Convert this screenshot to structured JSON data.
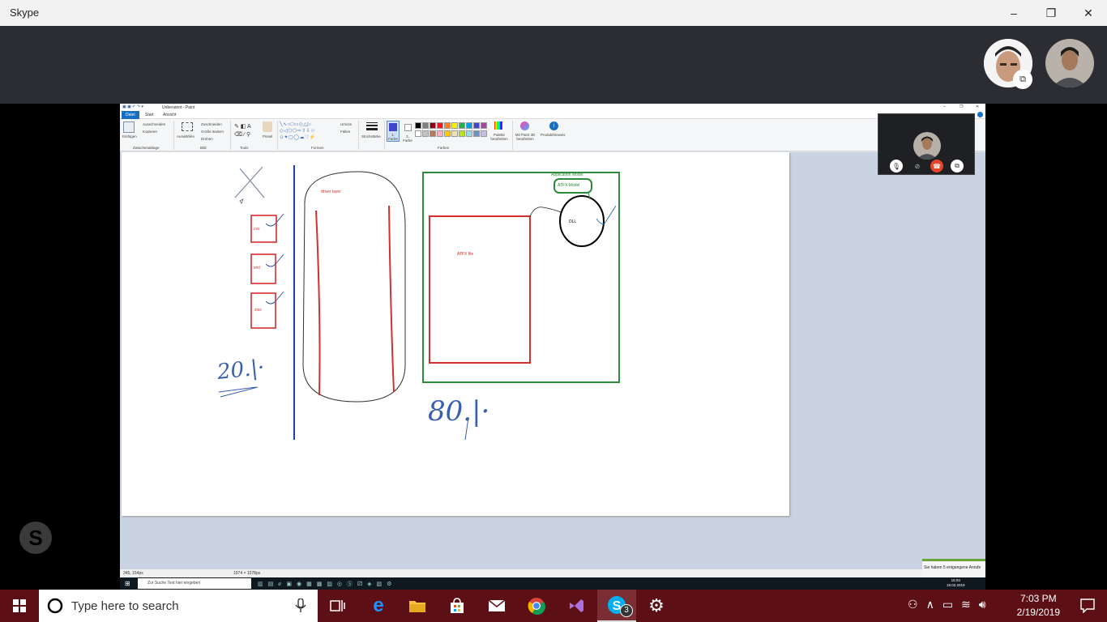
{
  "skype": {
    "title": "Skype",
    "window_controls": {
      "minimize": "–",
      "maximize": "❐",
      "close": "✕"
    },
    "brand_color": "#00aff0"
  },
  "remote_paint": {
    "window_title": "Unbenannt - Paint",
    "tabs": [
      "Datei",
      "Start",
      "Ansicht"
    ],
    "ribbon": {
      "clipboard": {
        "paste": "Einfügen",
        "cut": "Ausschneiden",
        "copy": "Kopieren",
        "group": "Zwischenablage"
      },
      "image": {
        "select": "Auswählen",
        "crop": "Zuschneiden",
        "resize": "Größe ändern",
        "rotate": "Drehen",
        "group": "Bild"
      },
      "tools": {
        "group": "Tools"
      },
      "brushes": {
        "label": "Pinsel"
      },
      "shapes": {
        "outline": "Umriss",
        "fill": "Füllen",
        "group": "Formen"
      },
      "stroke": {
        "label": "Strichstärke"
      },
      "colors": {
        "color1": "1. Farbe",
        "color2": "2. Farbe",
        "edit": "Palette bearbeiten",
        "group": "Farben"
      },
      "paint3d": {
        "label": "Mit Paint 3D bearbeiten"
      },
      "alert": {
        "label": "Produkthinweis"
      }
    },
    "palette": [
      "#000000",
      "#7f7f7f",
      "#880015",
      "#ed1c24",
      "#ff7f27",
      "#fff200",
      "#22b14c",
      "#00a2e8",
      "#3f48cc",
      "#a349a4",
      "#ffffff",
      "#c3c3c3",
      "#b97a57",
      "#ffaec9",
      "#ffc90e",
      "#efe4b0",
      "#b5e61d",
      "#99d9ea",
      "#7092be",
      "#c8bfe7"
    ],
    "status": {
      "cursor": "345, 154px",
      "canvas_size": "1974 × 1078px"
    },
    "remote_taskbar": {
      "search_placeholder": "Zur Suche Text hier eingeben",
      "time": "15:03",
      "date": "19.02.2019",
      "notification": "Sie haben 5 entgangene Anrufe"
    },
    "drawing": {
      "labels": {
        "csv": "csv",
        "xml": "xml",
        "xlsx": "xlsx",
        "driver_layer": "driver layer",
        "atfx_file": "ATFX file",
        "application_model": "Application Model",
        "atfx_model": "ATFX Model",
        "dll": "DLL",
        "percent_left": "20.|·",
        "percent_right": "80.|·"
      }
    }
  },
  "taskbar": {
    "search_placeholder": "Type here to search",
    "skype_badge": "3",
    "time": "7:03 PM",
    "date": "2/19/2019",
    "accent": "#5c0f14"
  }
}
